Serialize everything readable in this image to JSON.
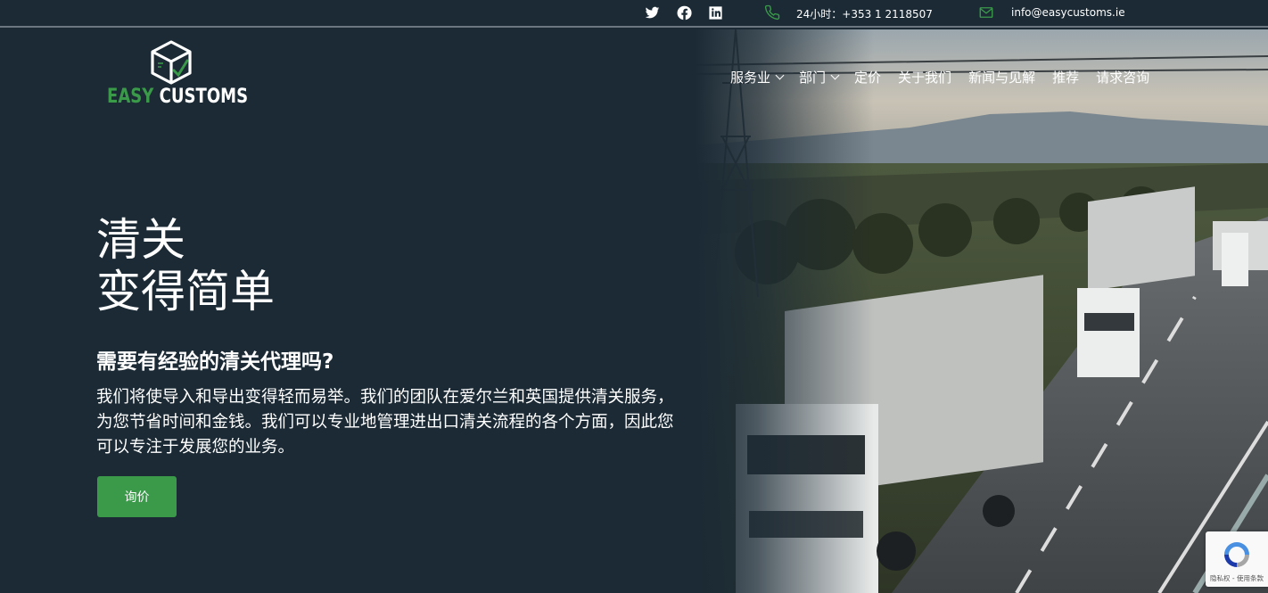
{
  "topbar": {
    "social": [
      "twitter-icon",
      "facebook-icon",
      "linkedin-icon"
    ],
    "phone_label": "24小时：+353 1 2118507",
    "email": "info@easycustoms.ie"
  },
  "logo": {
    "easy": "EASY",
    "customs": "CUSTOMS"
  },
  "nav": {
    "items": [
      {
        "label": "服务业",
        "dropdown": true
      },
      {
        "label": "部门",
        "dropdown": true
      },
      {
        "label": "定价",
        "dropdown": false
      },
      {
        "label": "关于我们",
        "dropdown": false
      },
      {
        "label": "新闻与见解",
        "dropdown": false
      },
      {
        "label": "推荐",
        "dropdown": false
      },
      {
        "label": "请求咨询",
        "dropdown": false
      }
    ]
  },
  "hero": {
    "title_line1": "清关",
    "title_line2": "变得简单",
    "subtitle": "需要有经验的清关代理吗?",
    "paragraph": "我们将使导入和导出变得轻而易举。我们的团队在爱尔兰和英国提供清关服务，为您节省时间和金钱。我们可以专业地管理进出口清关流程的各个方面，因此您可以专注于发展您的业务。",
    "cta_label": "询价"
  },
  "recaptcha": {
    "text": "隐私权 - 使用条款"
  },
  "colors": {
    "background": "#1b2a35",
    "accent": "#3a9a4a"
  }
}
